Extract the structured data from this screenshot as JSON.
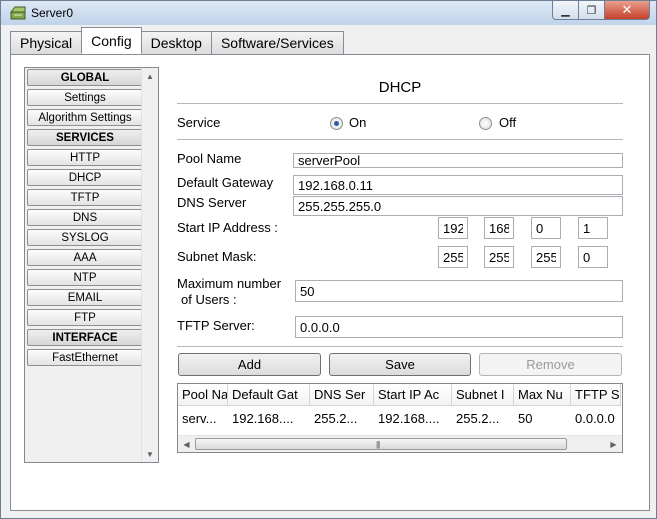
{
  "window": {
    "title": "Server0",
    "icon": "server-icon",
    "controls": {
      "minimize": "minimize-icon",
      "maximize": "maximize-icon",
      "close": "close-icon"
    }
  },
  "tabs": [
    {
      "label": "Physical",
      "active": false
    },
    {
      "label": "Config",
      "active": true
    },
    {
      "label": "Desktop",
      "active": false
    },
    {
      "label": "Software/Services",
      "active": false
    }
  ],
  "sidebar": {
    "items": [
      {
        "label": "GLOBAL",
        "header": true
      },
      {
        "label": "Settings",
        "header": false
      },
      {
        "label": "Algorithm Settings",
        "header": false
      },
      {
        "label": "SERVICES",
        "header": true
      },
      {
        "label": "HTTP",
        "header": false
      },
      {
        "label": "DHCP",
        "header": false
      },
      {
        "label": "TFTP",
        "header": false
      },
      {
        "label": "DNS",
        "header": false
      },
      {
        "label": "SYSLOG",
        "header": false
      },
      {
        "label": "AAA",
        "header": false
      },
      {
        "label": "NTP",
        "header": false
      },
      {
        "label": "EMAIL",
        "header": false
      },
      {
        "label": "FTP",
        "header": false
      },
      {
        "label": "INTERFACE",
        "header": true
      },
      {
        "label": "FastEthernet",
        "header": false
      }
    ]
  },
  "dhcp": {
    "title": "DHCP",
    "service_label": "Service",
    "on_label": "On",
    "off_label": "Off",
    "service_state": "On",
    "pool_name_label": "Pool Name",
    "pool_name_value": "serverPool",
    "gateway_label": "Default Gateway",
    "gateway_value": "192.168.0.11",
    "dns_label": "DNS Server",
    "dns_value": "255.255.255.0",
    "start_ip_label": "Start IP Address :",
    "start_ip": [
      "192",
      "168",
      "0",
      "1"
    ],
    "subnet_label": "Subnet Mask:",
    "subnet": [
      "255",
      "255",
      "255",
      "0"
    ],
    "max_users_label_1": "Maximum number",
    "max_users_label_2": "of Users :",
    "max_users_value": "50",
    "tftp_label": "TFTP Server:",
    "tftp_value": "0.0.0.0",
    "buttons": {
      "add": "Add",
      "save": "Save",
      "remove": "Remove"
    },
    "table": {
      "headers": [
        "Pool Na",
        "Default Gat",
        "DNS Ser",
        "Start IP Ac",
        "Subnet I",
        "Max Nu",
        "TFTP S"
      ],
      "rows": [
        [
          "serv...",
          "192.168....",
          "255.2...",
          "192.168....",
          "255.2...",
          "50",
          "0.0.0.0"
        ]
      ]
    }
  }
}
